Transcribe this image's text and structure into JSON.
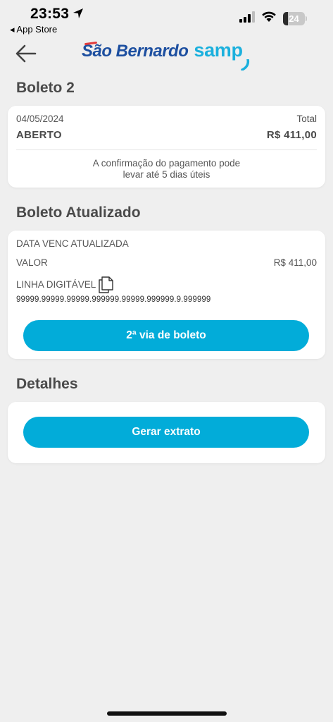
{
  "status_bar": {
    "time": "23:53",
    "back_app": "◂ App Store",
    "battery": "24",
    "battery_level": 0.24
  },
  "header": {
    "logo_part1": "São Bernardo",
    "logo_part2": "samp"
  },
  "boleto": {
    "title": "Boleto 2",
    "date": "04/05/2024",
    "total_label": "Total",
    "status": "ABERTO",
    "amount": "R$ 411,00",
    "notice_line1": "A confirmação do pagamento pode",
    "notice_line2": "levar até 5 dias úteis"
  },
  "boleto_atualizado": {
    "title": "Boleto Atualizado",
    "data_venc_label": "DATA VENC ATUALIZADA",
    "valor_label": "VALOR",
    "valor": "R$ 411,00",
    "linha_label": "LINHA DIGITÁVEL",
    "linha_value": "99999.99999.99999.999999.99999.999999.9.999999",
    "segunda_via_button": "2ª via de boleto"
  },
  "detalhes": {
    "title": "Detalhes",
    "gerar_extrato_button": "Gerar extrato"
  },
  "colors": {
    "accent": "#02acd9",
    "logo_blue": "#1d4fa0",
    "logo_cyan": "#1bb0dd",
    "background": "#efefef"
  },
  "icons": [
    "location-arrow-icon",
    "signal-icon",
    "wifi-icon",
    "battery-icon",
    "back-arrow-icon",
    "copy-icon"
  ]
}
